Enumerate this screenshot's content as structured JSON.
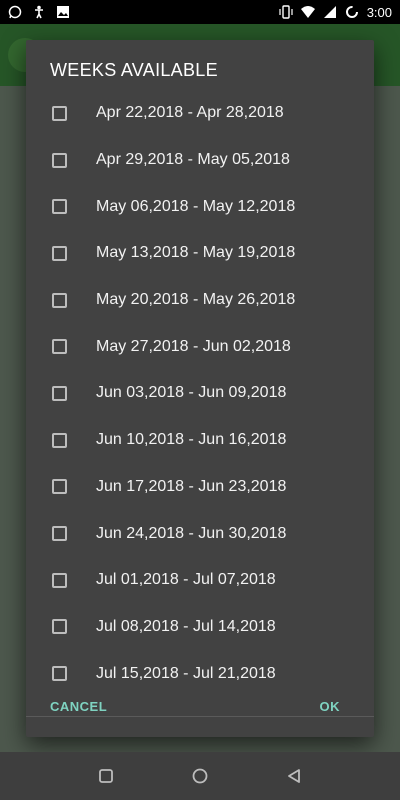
{
  "status_bar": {
    "time": "3:00",
    "left_icons": [
      "whatsapp-icon",
      "accessibility-icon",
      "image-icon"
    ],
    "right_icons": [
      "vibrate-icon",
      "wifi-icon",
      "signal-icon",
      "sync-icon"
    ]
  },
  "dialog": {
    "title": "WEEKS AVAILABLE",
    "items": [
      {
        "label": "Apr 22,2018 - Apr 28,2018",
        "checked": false
      },
      {
        "label": "Apr 29,2018 - May 05,2018",
        "checked": false
      },
      {
        "label": "May 06,2018 - May 12,2018",
        "checked": false
      },
      {
        "label": "May 13,2018 - May 19,2018",
        "checked": false
      },
      {
        "label": "May 20,2018 - May 26,2018",
        "checked": false
      },
      {
        "label": "May 27,2018 - Jun 02,2018",
        "checked": false
      },
      {
        "label": "Jun 03,2018 - Jun 09,2018",
        "checked": false
      },
      {
        "label": "Jun 10,2018 - Jun 16,2018",
        "checked": false
      },
      {
        "label": "Jun 17,2018 - Jun 23,2018",
        "checked": false
      },
      {
        "label": "Jun 24,2018 - Jun 30,2018",
        "checked": false
      },
      {
        "label": "Jul 01,2018 - Jul 07,2018",
        "checked": false
      },
      {
        "label": "Jul 08,2018 - Jul 14,2018",
        "checked": false
      },
      {
        "label": "Jul 15,2018 - Jul 21,2018",
        "checked": false
      }
    ],
    "cancel_label": "CANCEL",
    "ok_label": "OK"
  },
  "nav_bar": {
    "buttons": [
      "recents-icon",
      "home-icon",
      "back-icon"
    ]
  },
  "colors": {
    "dialog_bg": "#424242",
    "accent": "#7fd3c1",
    "app_bar": "#2f6a30"
  }
}
